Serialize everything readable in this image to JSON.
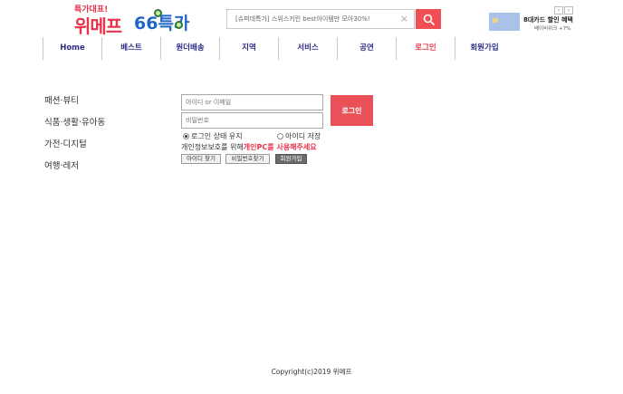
{
  "logo": {
    "tagline": "특가대표!",
    "name": "위메프",
    "badge": "66특가"
  },
  "search": {
    "value": "[슈퍼데특가] 스위스키린 best아이템만 모아30%!",
    "clear_icon": "×"
  },
  "ad": {
    "prev": "‹",
    "next": "›",
    "title": "8대카드 할인 혜택",
    "subtitle": "베이비위크 +7%"
  },
  "nav": {
    "items": [
      {
        "label": "Home"
      },
      {
        "label": "베스트"
      },
      {
        "label": "원더배송"
      },
      {
        "label": "지역"
      },
      {
        "label": "서비스"
      },
      {
        "label": "공연"
      },
      {
        "label": "로그인"
      },
      {
        "label": "회원가입"
      }
    ],
    "active_color": "#e8334a"
  },
  "categories": [
    {
      "label": "패션·뷰티"
    },
    {
      "label": "식품·생활·유아동"
    },
    {
      "label": "가전·디지털"
    },
    {
      "label": "여행·레저"
    }
  ],
  "login": {
    "id_placeholder": "아이디 or 이메일",
    "pw_placeholder": "비밀번호",
    "submit_label": "로그인",
    "keep_login_label": "로그인 상태 유지",
    "save_id_label": "아이디 저장",
    "notice_prefix": "개인정보보호를 위해",
    "notice_highlight": "개인PC를 사용해주세요",
    "find_id_label": "아이디 찾기",
    "find_pw_label": "비밀번호찾기",
    "join_label": "회원가입"
  },
  "footer": {
    "copyright": "Copyright(c)2019 위메프"
  },
  "colors": {
    "brand_red": "#ef4f55",
    "nav_text": "#2e2e87"
  }
}
